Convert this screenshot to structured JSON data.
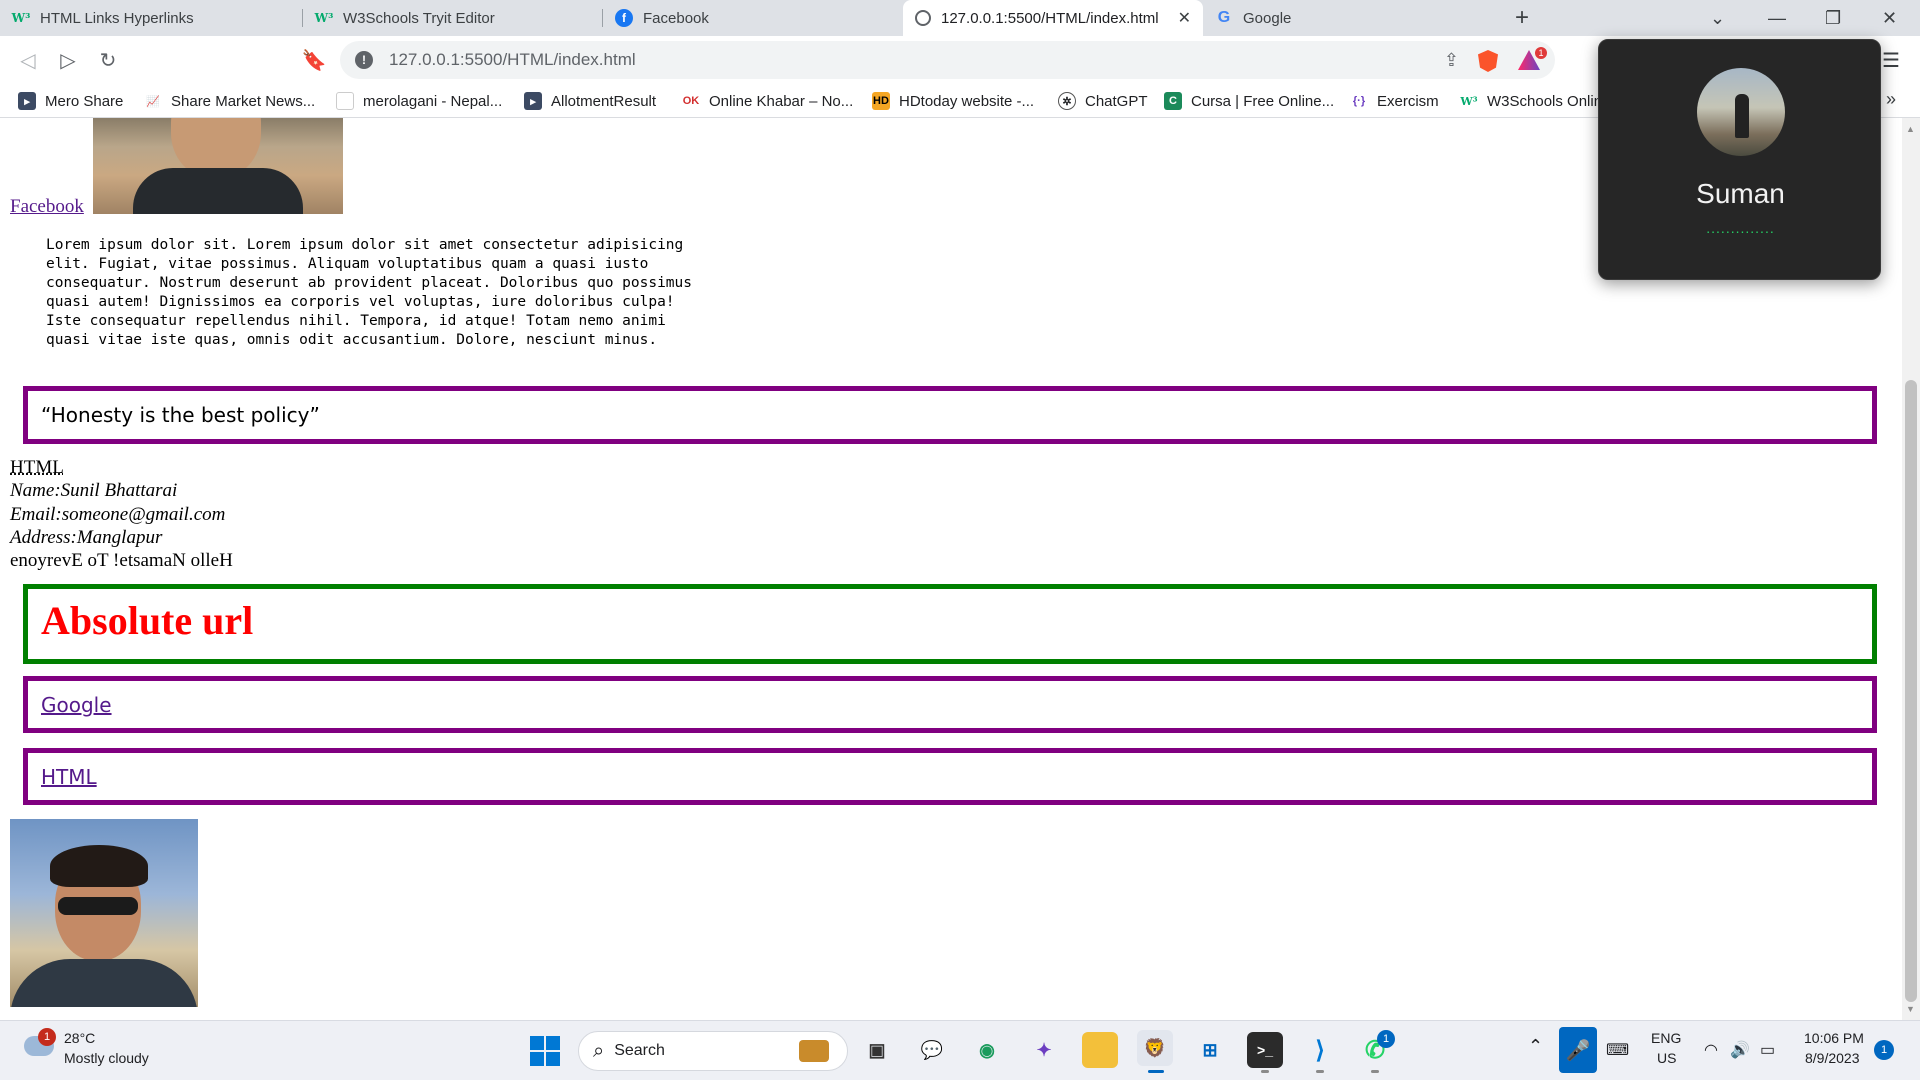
{
  "browser": {
    "tabs": [
      {
        "label": "HTML Links Hyperlinks",
        "icon": "w3schools-icon"
      },
      {
        "label": "W3Schools Tryit Editor",
        "icon": "w3schools-icon"
      },
      {
        "label": "Facebook",
        "icon": "facebook-icon"
      },
      {
        "label": "127.0.0.1:5500/HTML/index.html",
        "icon": "globe-icon",
        "active": true
      },
      {
        "label": "Google",
        "icon": "google-icon"
      }
    ],
    "url": "127.0.0.1:5500/HTML/index.html",
    "shields_badge": "1",
    "bookmarks": [
      {
        "label": "Mero Share",
        "icon": "bookmark-icon"
      },
      {
        "label": "Share Market News...",
        "icon": "chart-icon"
      },
      {
        "label": "merolagani - Nepal...",
        "icon": "page-icon"
      },
      {
        "label": "AllotmentResult",
        "icon": "bookmark-icon"
      },
      {
        "label": "Online Khabar – No...",
        "icon": "ok-icon"
      },
      {
        "label": "HDtoday website -...",
        "icon": "hd-icon"
      },
      {
        "label": "ChatGPT",
        "icon": "chatgpt-icon"
      },
      {
        "label": "Cursa | Free Online...",
        "icon": "cursa-icon"
      },
      {
        "label": "Exercism",
        "icon": "exercism-icon"
      },
      {
        "label": "W3Schools Online",
        "icon": "w3schools-icon"
      }
    ]
  },
  "page": {
    "facebook_link": "Facebook",
    "lorem_lines": [
      "Lorem ipsum dolor sit. Lorem ipsum dolor sit amet consectetur adipisicing",
      "elit. Fugiat, vitae possimus. Aliquam voluptatibus quam a quasi iusto",
      "consequatur. Nostrum deserunt ab provident placeat. Doloribus quo possimus",
      "quasi autem! Dignissimos ea corporis vel voluptas, iure doloribus culpa!",
      "Iste consequatur repellendus nihil. Tempora, id atque! Totam nemo animi",
      "quasi vitae iste quas, omnis odit accusantium. Dolore, nesciunt minus."
    ],
    "quote": "“Honesty is the best policy”",
    "abbr": "HTML",
    "name_line": "Name:Sunil Bhattarai",
    "email_line": "Email:someone@gmail.com",
    "address_line": "Address:Manglapur",
    "bdo_text": "enoyrevE oT !etsamaN olleH",
    "absolute_heading": "Absolute url",
    "google_link": "Google",
    "html_link": "HTML",
    "colors": {
      "purple_border": "#800080",
      "green_border": "#008000",
      "heading_red": "#ff0000",
      "visited_link": "#551a8b"
    }
  },
  "call_popup": {
    "caller_name": "Suman",
    "status_dots": "..............",
    "accent": "#25d366"
  },
  "taskbar": {
    "weather_temp": "28°C",
    "weather_desc": "Mostly cloudy",
    "weather_badge": "1",
    "search_label": "Search",
    "whatsapp_badge": "1",
    "lang_top": "ENG",
    "lang_bottom": "US",
    "time": "10:06 PM",
    "date": "8/9/2023",
    "notification_count": "1"
  }
}
